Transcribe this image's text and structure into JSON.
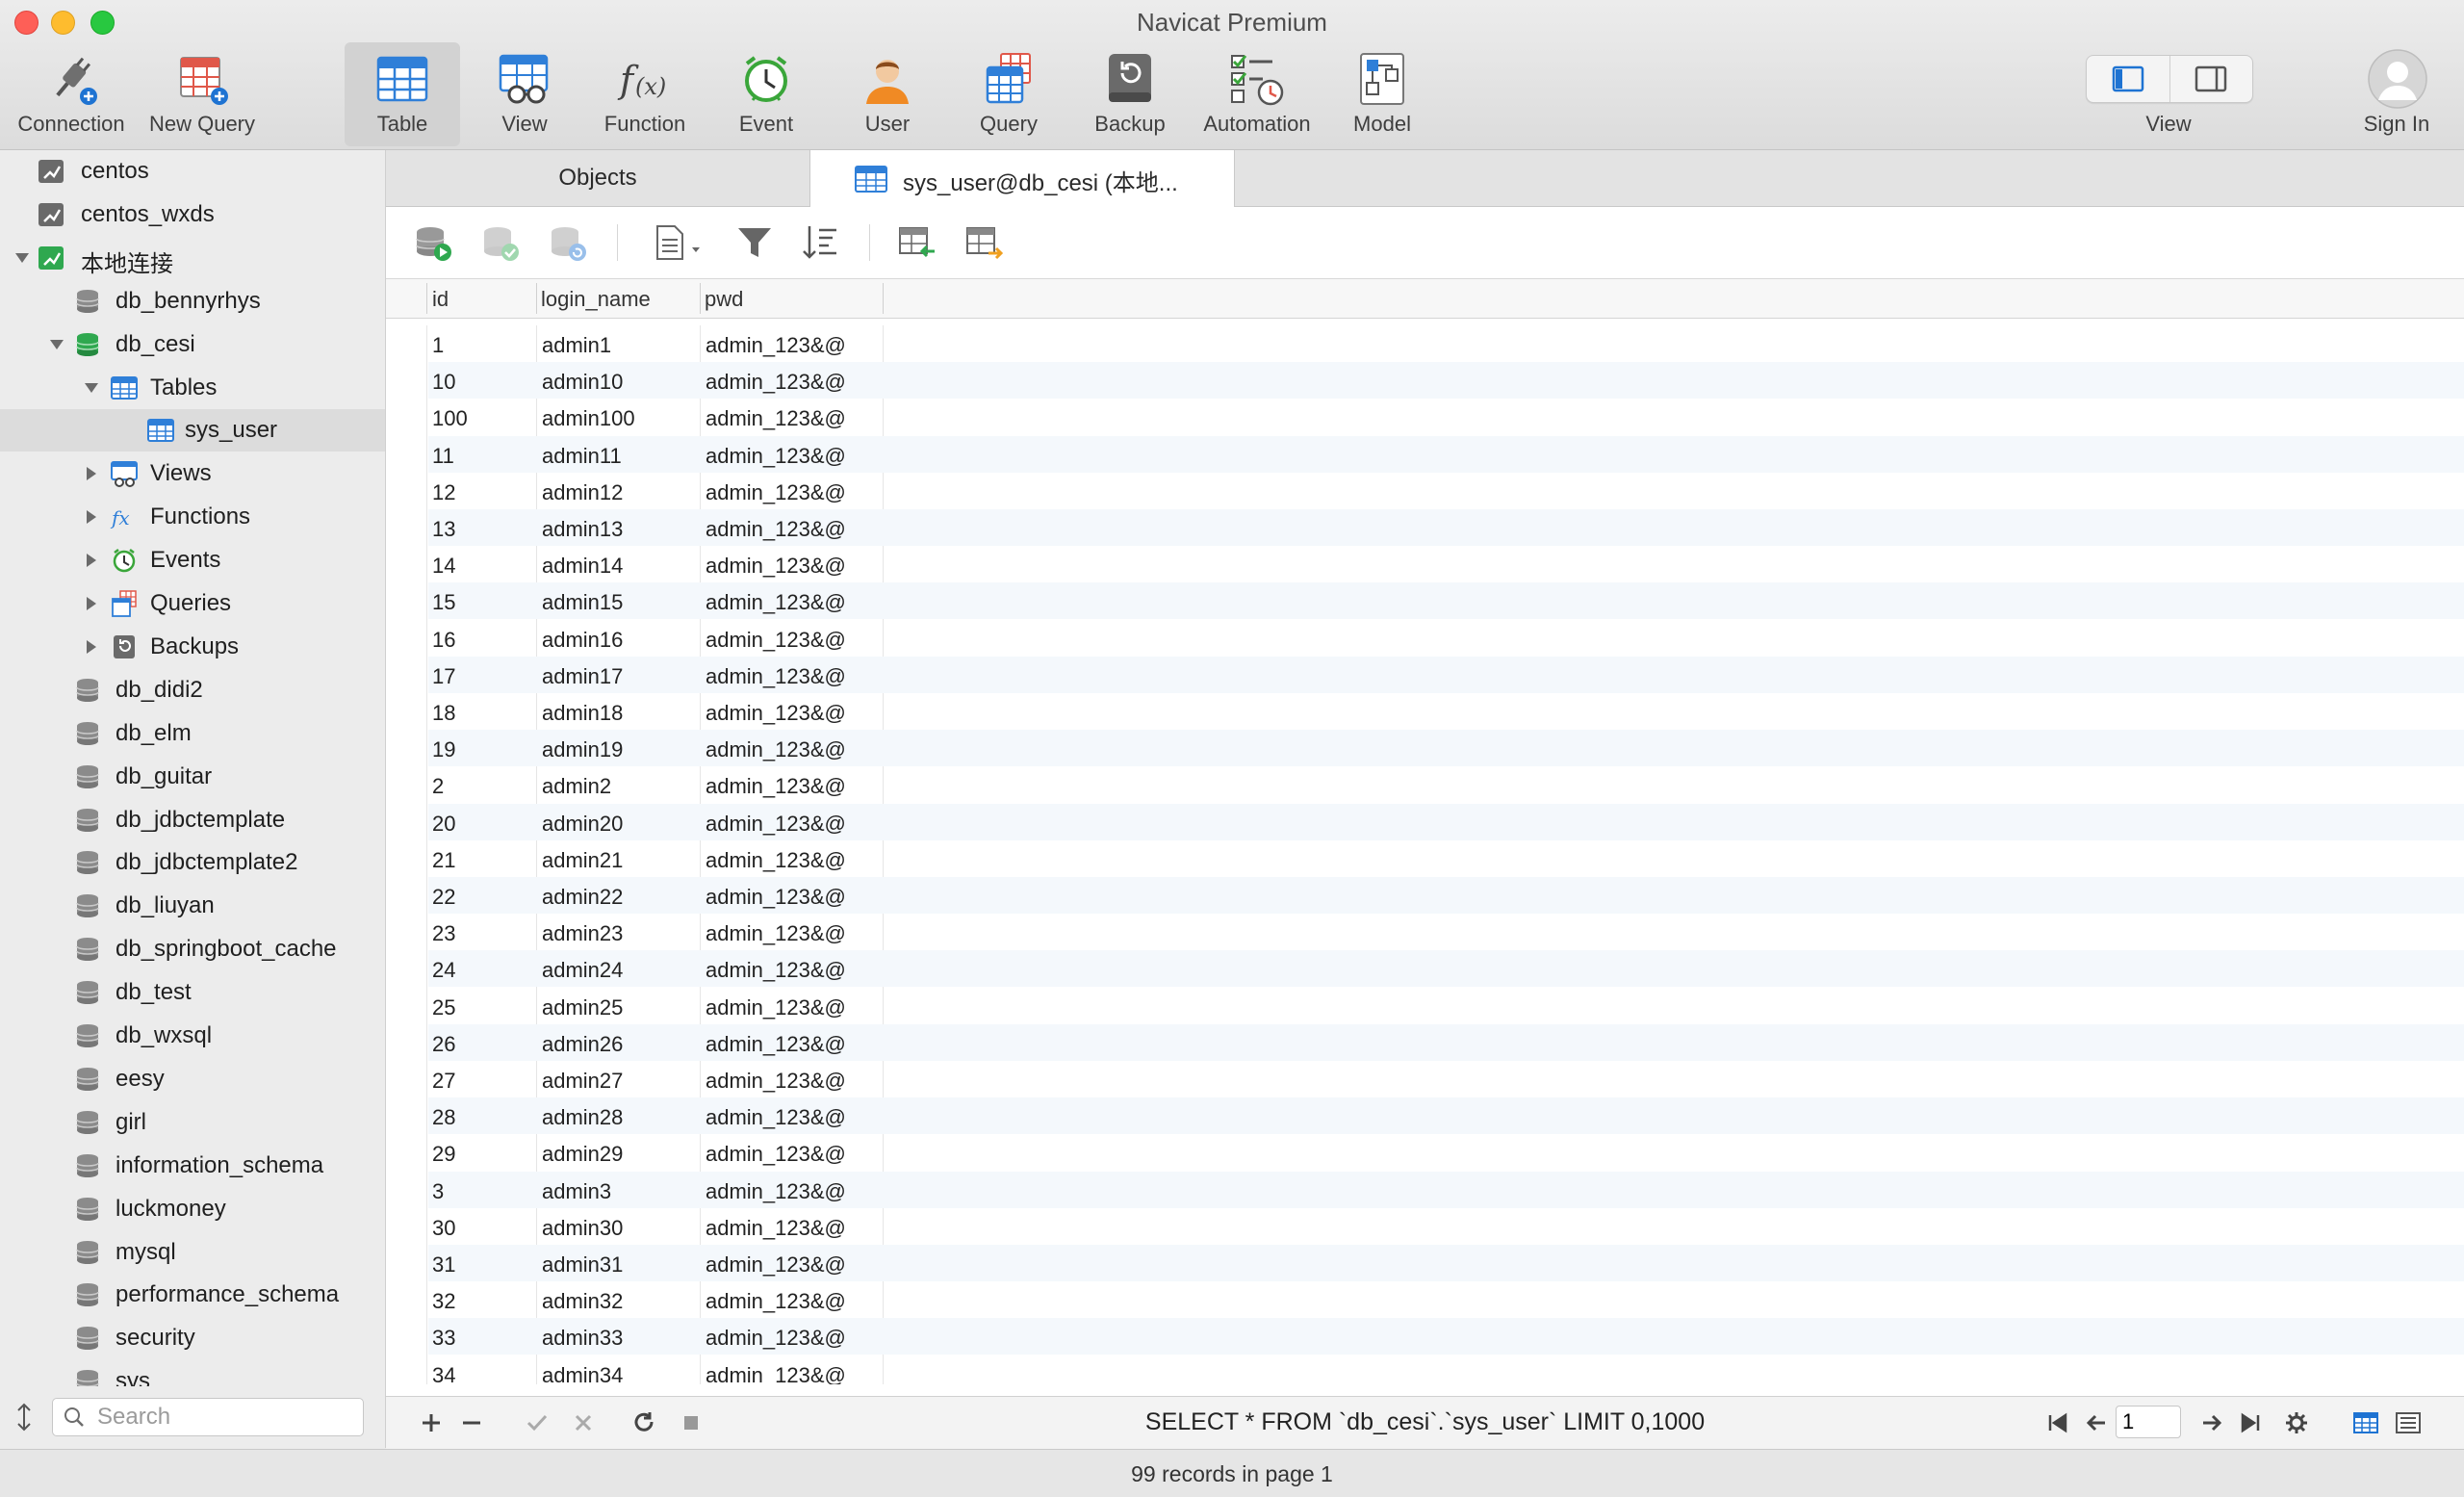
{
  "window": {
    "title": "Navicat Premium"
  },
  "toolbar": {
    "connection": "Connection",
    "new_query": "New Query",
    "table": "Table",
    "view": "View",
    "function": "Function",
    "event": "Event",
    "user": "User",
    "query": "Query",
    "backup": "Backup",
    "automation": "Automation",
    "model": "Model",
    "view_toggle": "View",
    "sign_in": "Sign In"
  },
  "sidebar": {
    "items": [
      {
        "label": "centos",
        "kind": "connection",
        "level": 0
      },
      {
        "label": "centos_wxds",
        "kind": "connection",
        "level": 0
      },
      {
        "label": "本地连接",
        "kind": "connection",
        "level": 0,
        "expanded": true
      },
      {
        "label": "db_bennyrhys",
        "kind": "database",
        "level": 1
      },
      {
        "label": "db_cesi",
        "kind": "database",
        "level": 1,
        "expanded": true
      },
      {
        "label": "Tables",
        "kind": "tables",
        "level": 2,
        "expanded": true
      },
      {
        "label": "sys_user",
        "kind": "table",
        "level": 3,
        "selected": true
      },
      {
        "label": "Views",
        "kind": "views",
        "level": 2
      },
      {
        "label": "Functions",
        "kind": "functions",
        "level": 2
      },
      {
        "label": "Events",
        "kind": "events",
        "level": 2
      },
      {
        "label": "Queries",
        "kind": "queries",
        "level": 2
      },
      {
        "label": "Backups",
        "kind": "backups",
        "level": 2
      },
      {
        "label": "db_didi2",
        "kind": "database",
        "level": 1
      },
      {
        "label": "db_elm",
        "kind": "database",
        "level": 1
      },
      {
        "label": "db_guitar",
        "kind": "database",
        "level": 1
      },
      {
        "label": "db_jdbctemplate",
        "kind": "database",
        "level": 1
      },
      {
        "label": "db_jdbctemplate2",
        "kind": "database",
        "level": 1
      },
      {
        "label": "db_liuyan",
        "kind": "database",
        "level": 1
      },
      {
        "label": "db_springboot_cache",
        "kind": "database",
        "level": 1
      },
      {
        "label": "db_test",
        "kind": "database",
        "level": 1
      },
      {
        "label": "db_wxsql",
        "kind": "database",
        "level": 1
      },
      {
        "label": "eesy",
        "kind": "database",
        "level": 1
      },
      {
        "label": "girl",
        "kind": "database",
        "level": 1
      },
      {
        "label": "information_schema",
        "kind": "database",
        "level": 1
      },
      {
        "label": "luckmoney",
        "kind": "database",
        "level": 1
      },
      {
        "label": "mysql",
        "kind": "database",
        "level": 1
      },
      {
        "label": "performance_schema",
        "kind": "database",
        "level": 1
      },
      {
        "label": "security",
        "kind": "database",
        "level": 1
      },
      {
        "label": "sys",
        "kind": "database",
        "level": 1
      }
    ],
    "search_placeholder": "Search"
  },
  "tabs": {
    "objects": "Objects",
    "active": "sys_user@db_cesi (本地..."
  },
  "grid": {
    "columns": [
      "id",
      "login_name",
      "pwd"
    ],
    "rows": [
      [
        "1",
        "admin1",
        "admin_123&@"
      ],
      [
        "10",
        "admin10",
        "admin_123&@"
      ],
      [
        "100",
        "admin100",
        "admin_123&@"
      ],
      [
        "11",
        "admin11",
        "admin_123&@"
      ],
      [
        "12",
        "admin12",
        "admin_123&@"
      ],
      [
        "13",
        "admin13",
        "admin_123&@"
      ],
      [
        "14",
        "admin14",
        "admin_123&@"
      ],
      [
        "15",
        "admin15",
        "admin_123&@"
      ],
      [
        "16",
        "admin16",
        "admin_123&@"
      ],
      [
        "17",
        "admin17",
        "admin_123&@"
      ],
      [
        "18",
        "admin18",
        "admin_123&@"
      ],
      [
        "19",
        "admin19",
        "admin_123&@"
      ],
      [
        "2",
        "admin2",
        "admin_123&@"
      ],
      [
        "20",
        "admin20",
        "admin_123&@"
      ],
      [
        "21",
        "admin21",
        "admin_123&@"
      ],
      [
        "22",
        "admin22",
        "admin_123&@"
      ],
      [
        "23",
        "admin23",
        "admin_123&@"
      ],
      [
        "24",
        "admin24",
        "admin_123&@"
      ],
      [
        "25",
        "admin25",
        "admin_123&@"
      ],
      [
        "26",
        "admin26",
        "admin_123&@"
      ],
      [
        "27",
        "admin27",
        "admin_123&@"
      ],
      [
        "28",
        "admin28",
        "admin_123&@"
      ],
      [
        "29",
        "admin29",
        "admin_123&@"
      ],
      [
        "3",
        "admin3",
        "admin_123&@"
      ],
      [
        "30",
        "admin30",
        "admin_123&@"
      ],
      [
        "31",
        "admin31",
        "admin_123&@"
      ],
      [
        "32",
        "admin32",
        "admin_123&@"
      ],
      [
        "33",
        "admin33",
        "admin_123&@"
      ],
      [
        "34",
        "admin34",
        "admin_123&@"
      ]
    ]
  },
  "footer": {
    "sql": "SELECT * FROM `db_cesi`.`sys_user` LIMIT 0,1000",
    "page": "1"
  },
  "status": {
    "text": "99 records in page 1"
  },
  "colors": {
    "accent": "#1e73d2",
    "green": "#2fa84f",
    "selected_row": "#dcdcdc"
  }
}
